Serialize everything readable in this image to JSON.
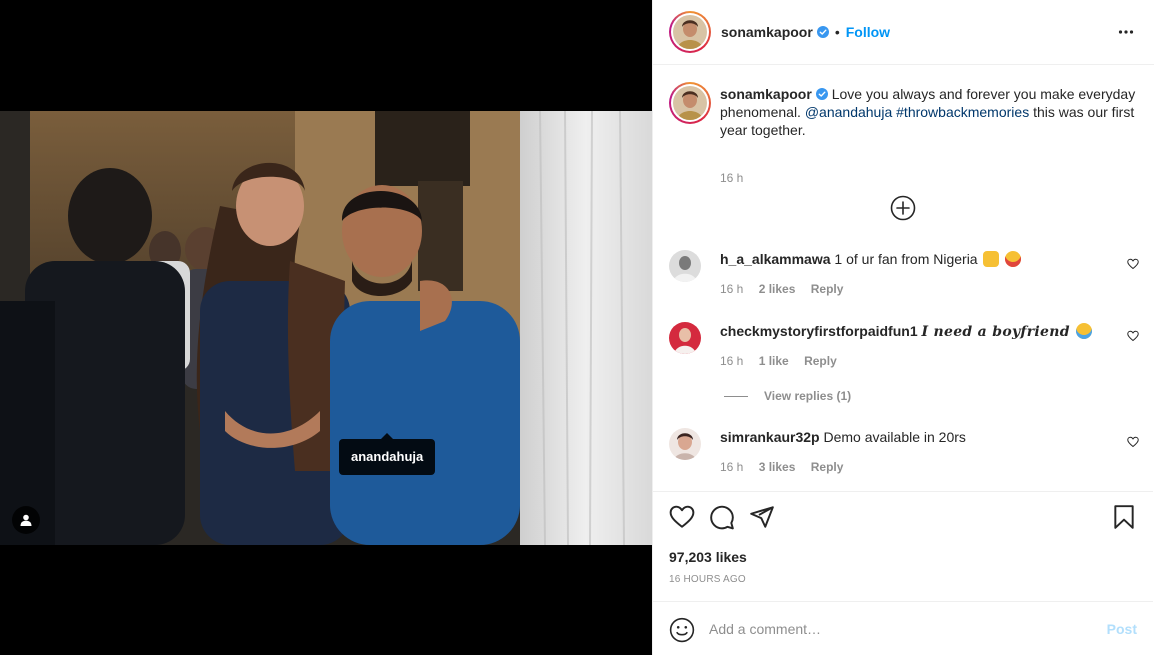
{
  "media": {
    "tag_label": "anandahuja"
  },
  "header": {
    "username": "sonamkapoor",
    "separator": "•",
    "follow_label": "Follow"
  },
  "caption": {
    "username": "sonamkapoor",
    "text_1": "Love you always and forever you make everyday phenomenal.",
    "mention": "@anandahuja",
    "hashtag": "#throwbackmemories",
    "text_2": "this was our first year together.",
    "time": "16 h"
  },
  "comments": [
    {
      "username": "h_a_alkammawa",
      "text": "1 of ur fan from Nigeria",
      "time": "16 h",
      "likes": "2 likes",
      "reply": "Reply"
    },
    {
      "username": "checkmystoryfirstforpaidfun1",
      "text": "𝑰 𝒏𝒆𝒆𝒅 𝒂 𝒃𝒐𝒚𝒇𝒓𝒊𝒆𝒏𝒅",
      "time": "16 h",
      "likes": "1 like",
      "reply": "Reply"
    },
    {
      "username": "simrankaur32p",
      "text": "Demo available in 20rs",
      "time": "16 h",
      "likes": "3 likes",
      "reply": "Reply"
    }
  ],
  "view_replies": "View replies (1)",
  "stats": {
    "likes": "97,203 likes",
    "time_ago": "16 HOURS AGO"
  },
  "add_comment": {
    "placeholder": "Add a comment…",
    "post_label": "Post"
  },
  "colors": {
    "link_blue": "#0095f6",
    "tag_blue": "#00376b",
    "muted": "#8e8e8e",
    "post_disabled": "#b2dffc"
  }
}
